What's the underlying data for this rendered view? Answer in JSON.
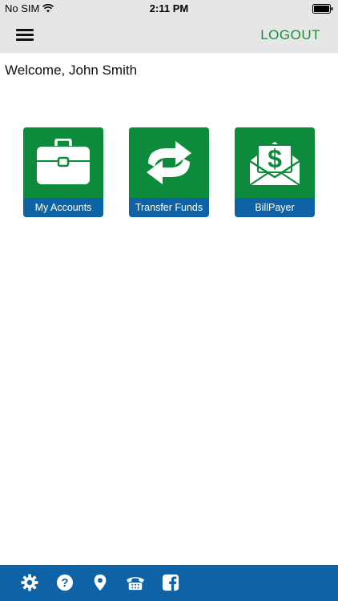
{
  "status_bar": {
    "carrier": "No SIM",
    "time": "2:11 PM",
    "wifi_icon": "wifi-icon",
    "battery_icon": "battery-icon"
  },
  "nav": {
    "menu_icon": "hamburger-menu-icon",
    "logout_label": "LOGOUT"
  },
  "welcome_text": "Welcome, John Smith",
  "tiles": [
    {
      "label": "My Accounts",
      "icon": "briefcase-icon"
    },
    {
      "label": "Transfer Funds",
      "icon": "refresh-arrows-icon"
    },
    {
      "label": "BillPayer",
      "icon": "dollar-envelope-icon"
    }
  ],
  "footer_icons": [
    "gear-icon",
    "help-icon",
    "location-pin-icon",
    "telephone-icon",
    "facebook-icon"
  ],
  "colors": {
    "tile_green": "#0e8a3c",
    "tile_blue": "#0d63a5",
    "logout_green": "#1e8a3c",
    "bar_gray": "#e6e6e6"
  }
}
